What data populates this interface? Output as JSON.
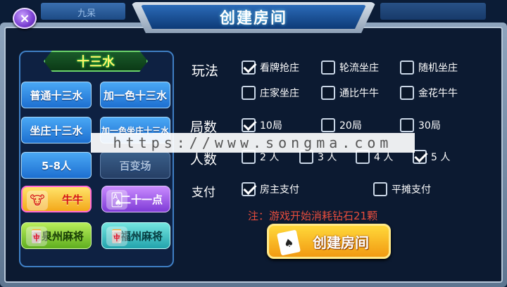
{
  "top_strip": {
    "label": "九呆"
  },
  "close_icon": "×",
  "dialog": {
    "title": "创建房间"
  },
  "left_panel": {
    "category": "十三水",
    "modes": [
      {
        "label": "普通十三水"
      },
      {
        "label": "加一色十三水"
      },
      {
        "label": "坐庄十三水"
      },
      {
        "label": "加一色坐庄十三水"
      },
      {
        "label": "5-8人"
      },
      {
        "label": "百变场"
      }
    ],
    "games": [
      {
        "label": "牛牛",
        "icon": "cow-icon",
        "glyph": "🐮"
      },
      {
        "label": "二十一点",
        "icon": "cards-icon",
        "glyph": "🂡"
      },
      {
        "label": "泉州麻将",
        "icon": "mahjong-icon",
        "glyph": "🀄"
      },
      {
        "label": "福州麻将",
        "icon": "mahjong-icon",
        "glyph": "🀄"
      }
    ]
  },
  "options": {
    "play_label": "玩法",
    "play": [
      {
        "label": "看牌抢庄",
        "checked": true
      },
      {
        "label": "轮流坐庄",
        "checked": false
      },
      {
        "label": "随机坐庄",
        "checked": false
      },
      {
        "label": "庄家坐庄",
        "checked": false
      },
      {
        "label": "通比牛牛",
        "checked": false
      },
      {
        "label": "金花牛牛",
        "checked": false
      }
    ],
    "rounds_label": "局数",
    "rounds": [
      {
        "label": "10局",
        "checked": true
      },
      {
        "label": "20局",
        "checked": false
      },
      {
        "label": "30局",
        "checked": false
      }
    ],
    "players_label": "人数",
    "players": [
      {
        "label": "2 人",
        "checked": false
      },
      {
        "label": "3 人",
        "checked": false
      },
      {
        "label": "4 人",
        "checked": false
      },
      {
        "label": "5 人",
        "checked": true
      }
    ],
    "pay_label": "支付",
    "pay": [
      {
        "label": "房主支付",
        "checked": true
      },
      {
        "label": "平摊支付",
        "checked": false
      }
    ]
  },
  "note": "注：游戏开始消耗钻石21颗",
  "create_button": {
    "label": "创建房间",
    "icon": "♠"
  },
  "watermark": "https://www.songma.com",
  "colors": {
    "accent_blue": "#1d6fd0",
    "note_red": "#e84d3d",
    "button_gold": "#f29a12"
  }
}
